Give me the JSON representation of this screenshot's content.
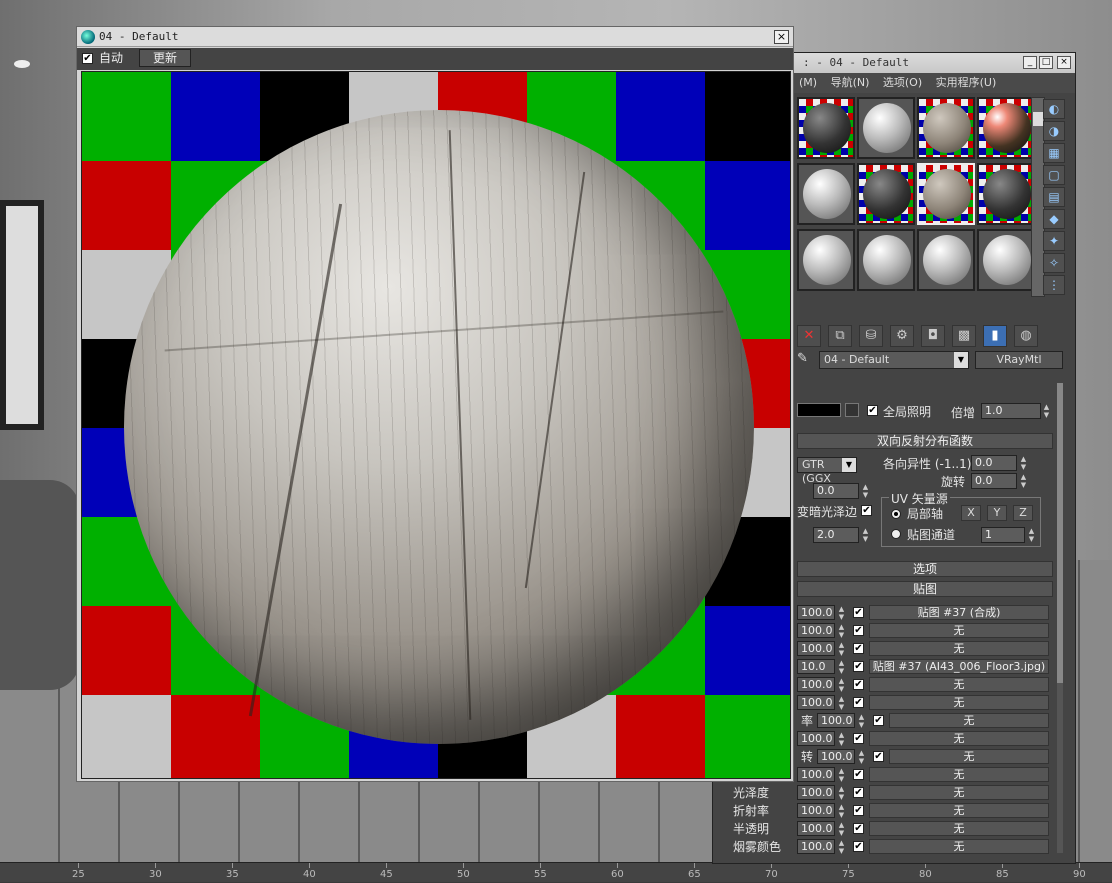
{
  "preview": {
    "title": "04 - Default",
    "close": "×",
    "auto_check": "✔",
    "auto_label": "自动",
    "update_label": "更新",
    "colors": {
      "red": "#c80000",
      "green": "#00b000",
      "blue": "#0000b8",
      "black": "#000000",
      "gray": "#c6c6c6"
    }
  },
  "editor": {
    "title": ": - 04 - Default",
    "menus": [
      "(M)",
      "导航(N)",
      "选项(O)",
      "实用程序(U)"
    ],
    "material_name": "04 - Default",
    "material_type": "VRayMtl",
    "dropdown_arrow": "▼",
    "global_illumination_label": "全局照明",
    "multiplier_label": "倍增",
    "multiplier_value": "1.0",
    "brdf_header": "双向反射分布函数",
    "brdf_type": "GTR (GGX",
    "anisotropy_label": "各向异性 (-1..1)",
    "anisotropy_value": "0.0",
    "rotation_label": "旋转",
    "rotation_value": "0.0",
    "left_value_1": "0.0",
    "dark_glossy_label": "变暗光泽边",
    "left_value_2": "2.0",
    "uv_source_label": "UV 矢量源",
    "local_axis_label": "局部轴",
    "map_channel_label": "贴图通道",
    "map_channel_value": "1",
    "x_label": "X",
    "y_label": "Y",
    "z_label": "Z",
    "options_header": "选项",
    "maps_header": "贴图",
    "maps": [
      {
        "label": "",
        "value": "100.0",
        "map": "贴图 #37 (合成)"
      },
      {
        "label": "",
        "value": "100.0",
        "map": "无"
      },
      {
        "label": "",
        "value": "100.0",
        "map": "无"
      },
      {
        "label": "",
        "value": "10.0",
        "map": "贴图 #37 (AI43_006_Floor3.jpg)"
      },
      {
        "label": "",
        "value": "100.0",
        "map": "无"
      },
      {
        "label": "",
        "value": "100.0",
        "map": "无"
      },
      {
        "label": "率",
        "value": "100.0",
        "map": "无"
      },
      {
        "label": "",
        "value": "100.0",
        "map": "无"
      },
      {
        "label": "转",
        "value": "100.0",
        "map": "无"
      },
      {
        "label": "",
        "value": "100.0",
        "map": "无"
      },
      {
        "label": "光泽度",
        "value": "100.0",
        "map": "无"
      },
      {
        "label": "折射率",
        "value": "100.0",
        "map": "无"
      },
      {
        "label": "半透明",
        "value": "100.0",
        "map": "无"
      },
      {
        "label": "烟雾颜色",
        "value": "100.0",
        "map": "无"
      }
    ]
  },
  "timeline": {
    "ticks": [
      "25",
      "30",
      "35",
      "40",
      "45",
      "50",
      "55",
      "60",
      "65",
      "70",
      "75",
      "80",
      "85",
      "90"
    ]
  }
}
